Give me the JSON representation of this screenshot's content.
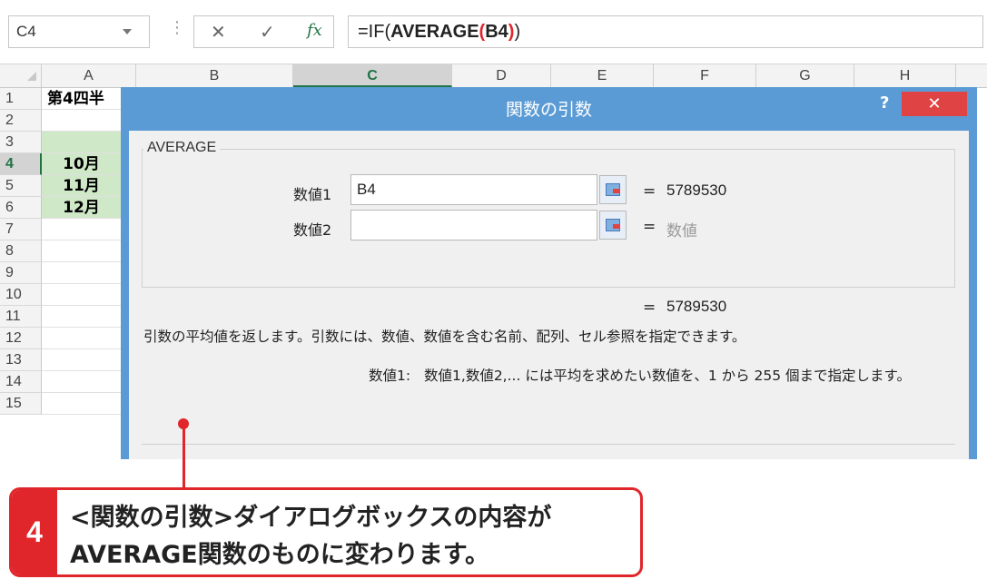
{
  "formula_bar": {
    "name_box": "C4",
    "cancel_icon": "✕",
    "enter_icon": "✓",
    "fx_icon": "fx",
    "formula_parts": [
      {
        "text": "=IF(",
        "color": "#222222",
        "bold": false
      },
      {
        "text": "AVERAGE",
        "color": "#222222",
        "bold": true
      },
      {
        "text": "(",
        "color": "#e0262b",
        "bold": true
      },
      {
        "text": "B4",
        "color": "#222222",
        "bold": true
      },
      {
        "text": ")",
        "color": "#e0262b",
        "bold": true
      },
      {
        "text": ")",
        "color": "#222222",
        "bold": false
      }
    ]
  },
  "sheet": {
    "columns": [
      "A",
      "B",
      "C",
      "D",
      "E",
      "F",
      "G",
      "H"
    ],
    "active_column": "C",
    "rows": [
      "1",
      "2",
      "3",
      "4",
      "5",
      "6",
      "7",
      "8",
      "9",
      "10",
      "11",
      "12",
      "13",
      "14",
      "15"
    ],
    "active_row": "4",
    "a1_text": "第4四半",
    "months": [
      "10月",
      "11月",
      "12月"
    ]
  },
  "dialog": {
    "title": "関数の引数",
    "help": "?",
    "close": "✕",
    "function_name": "AVERAGE",
    "args": [
      {
        "label": "数値1",
        "value": "B4",
        "result": "5789530",
        "placeholder": false
      },
      {
        "label": "数値2",
        "value": "",
        "result": "数値",
        "placeholder": true
      }
    ],
    "equals": "=",
    "formula_result": "5789530",
    "description": "引数の平均値を返します。引数には、数値、数値を含む名前、配列、セル参照を指定できます。",
    "arg_help_label": "数値1:",
    "arg_help_text": "数値1,数値2,... には平均を求めたい数値を、1 から 255 個まで指定します。"
  },
  "callout": {
    "step": "4",
    "line1": "<関数の引数>ダイアログボックスの内容が",
    "line2": "AVERAGE関数のものに変わります。"
  },
  "colors": {
    "dialog_blue": "#5b9bd5",
    "accent_red": "#e0262b",
    "excel_green": "#217346",
    "cell_green": "#cfe8c8"
  }
}
